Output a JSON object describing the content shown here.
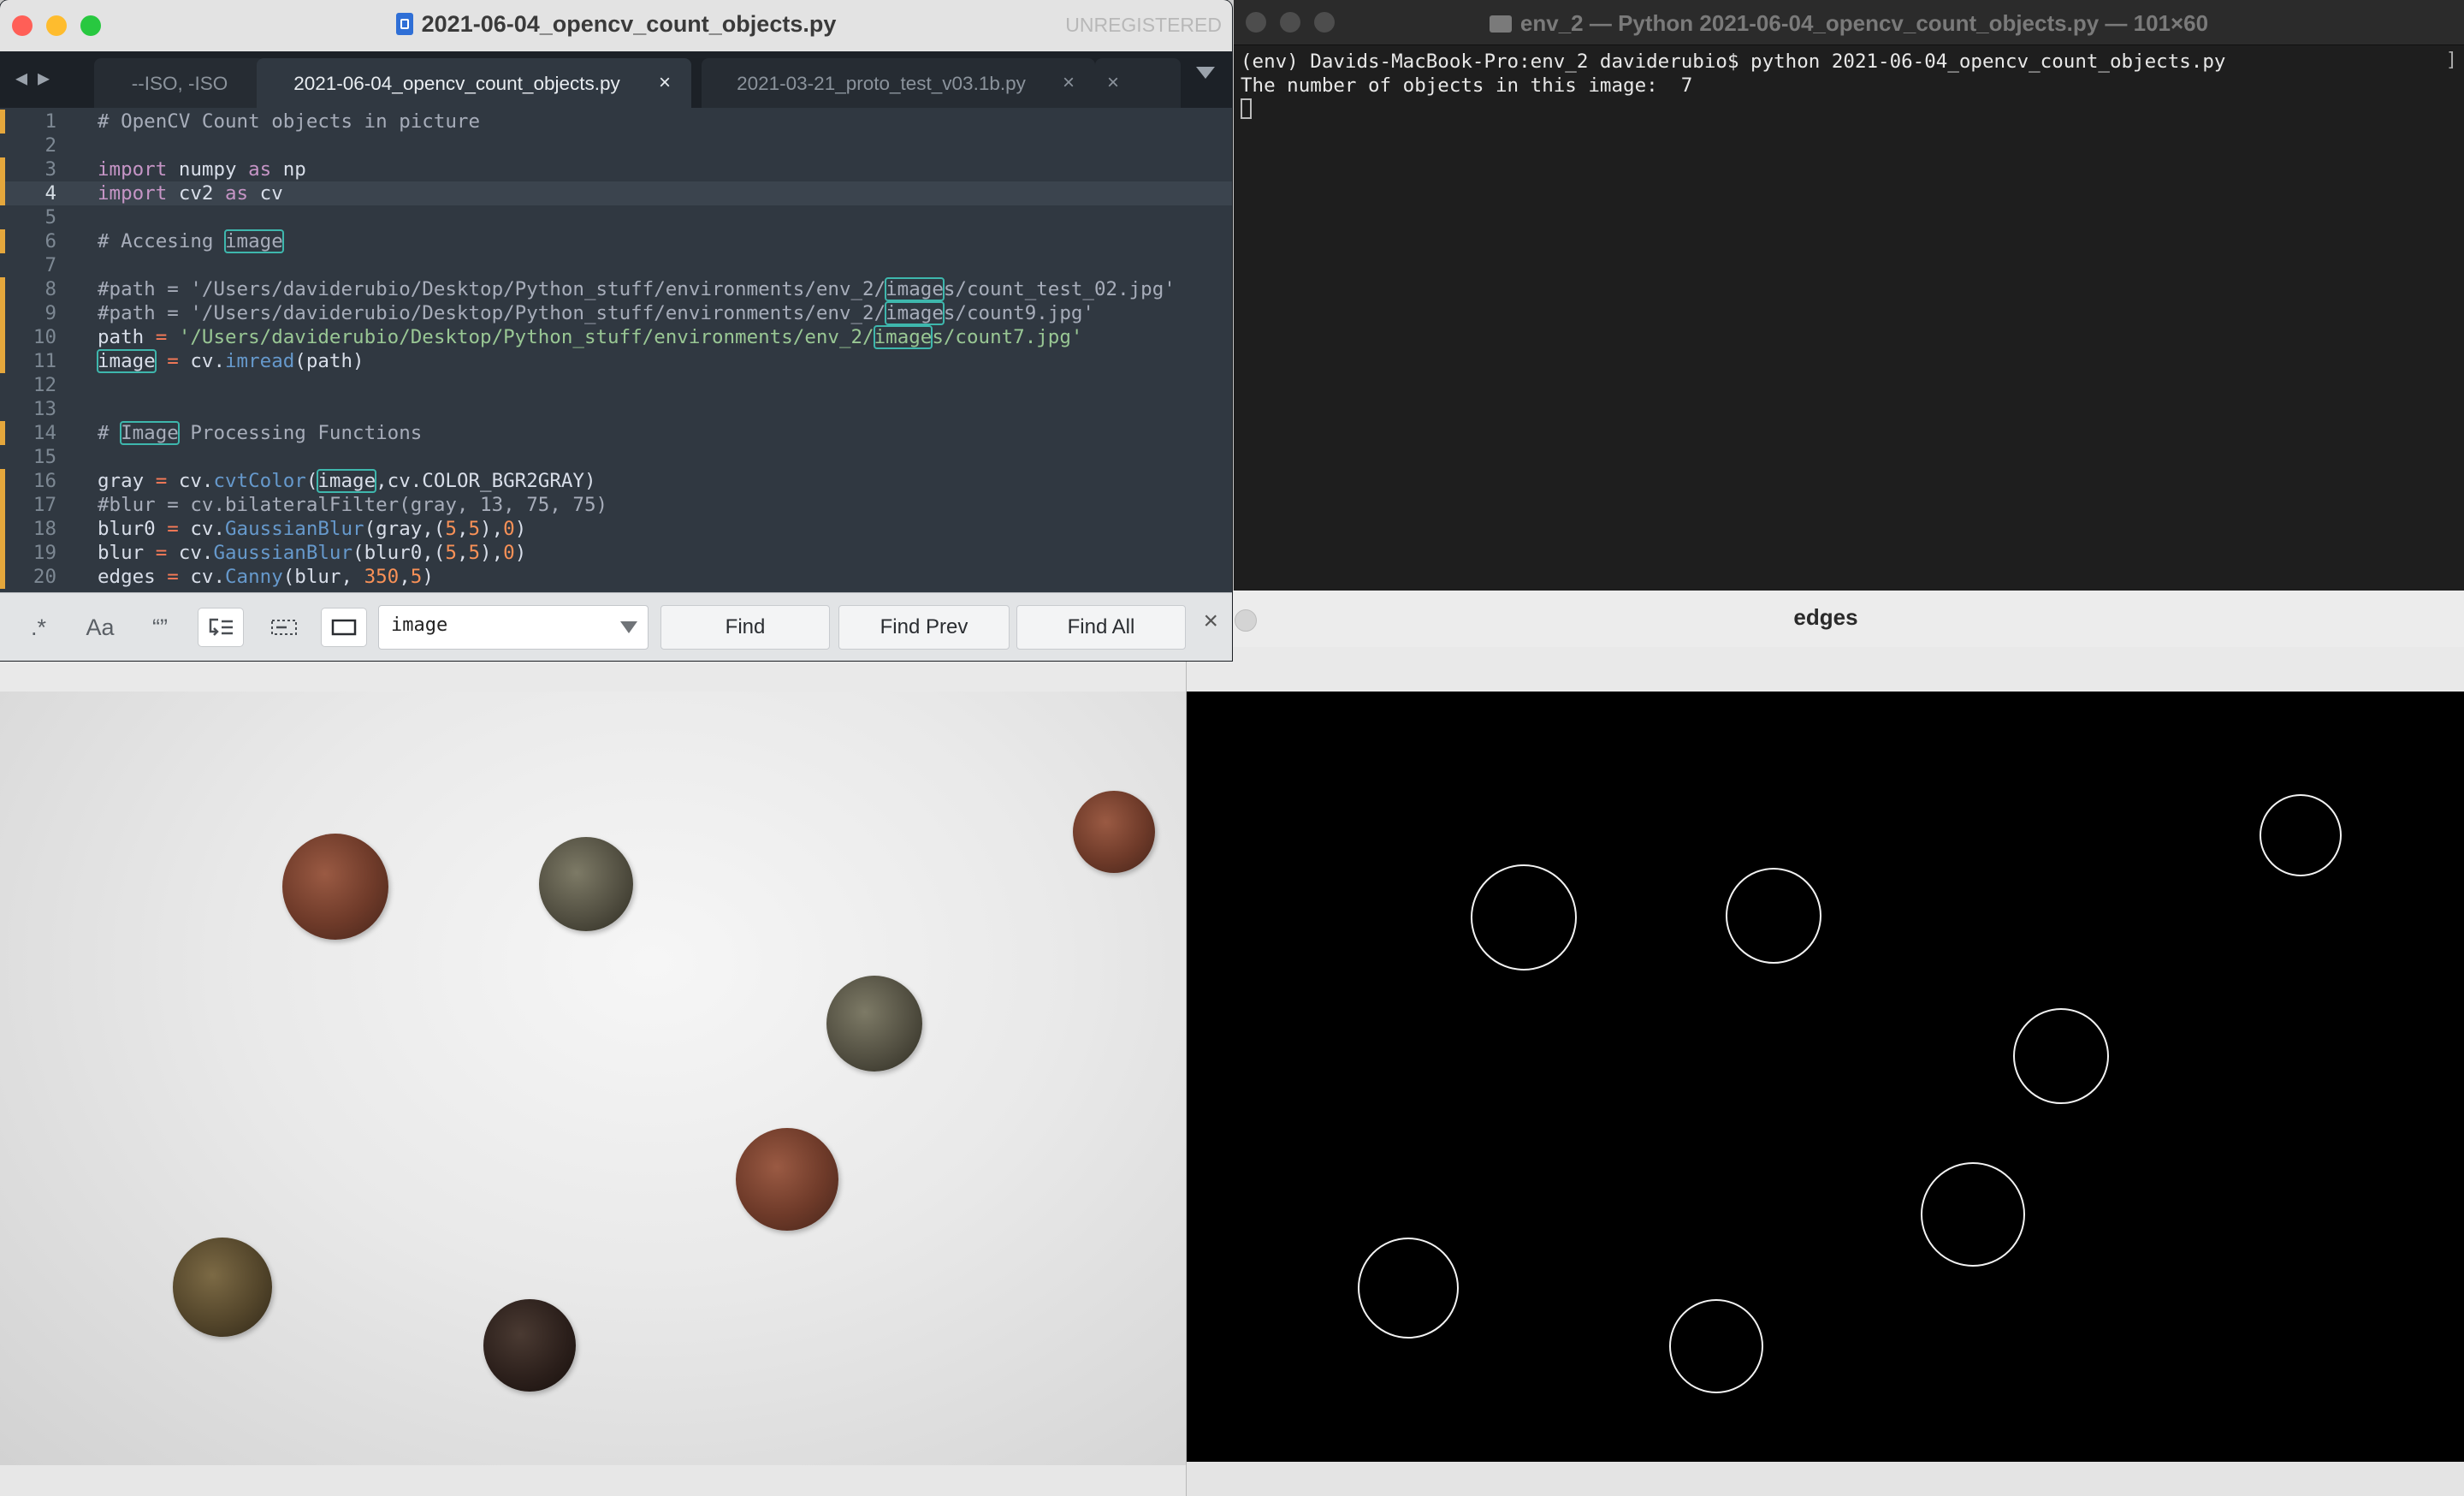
{
  "editor": {
    "title": "2021-06-04_opencv_count_objects.py",
    "license_status": "UNREGISTERED",
    "tabs": [
      {
        "label": "--ISO, -ISO",
        "active": false
      },
      {
        "label": "2021-06-04_opencv_count_objects.py",
        "active": true,
        "close": "×"
      },
      {
        "label": "2021-03-21_proto_test_v03.1b.py",
        "active": false,
        "close": "×"
      },
      {
        "label": "",
        "active": false,
        "close": "×"
      }
    ],
    "current_line": 4,
    "lines": [
      {
        "n": "1",
        "html": "<span class='c-com'># OpenCV Count objects in picture</span>"
      },
      {
        "n": "2",
        "html": ""
      },
      {
        "n": "3",
        "html": "<span class='c-kw'>import</span> numpy <span class='c-kw'>as</span> np"
      },
      {
        "n": "4",
        "html": "<span class='c-kw'>import</span> cv2 <span class='c-kw'>as</span> cv"
      },
      {
        "n": "5",
        "html": ""
      },
      {
        "n": "6",
        "html": "<span class='c-com'># Accesing <span class='hl'>image</span></span>"
      },
      {
        "n": "7",
        "html": ""
      },
      {
        "n": "8",
        "html": "<span class='c-com'>#path = '/Users/daviderubio/Desktop/Python_stuff/environments/env_2/<span class='hl'>image</span>s/count_test_02.jpg'</span>"
      },
      {
        "n": "9",
        "html": "<span class='c-com'>#path = '/Users/daviderubio/Desktop/Python_stuff/environments/env_2/<span class='hl'>image</span>s/count9.jpg'</span>"
      },
      {
        "n": "10",
        "html": "path <span class='c-op'>=</span> <span class='c-str'>'/Users/daviderubio/Desktop/Python_stuff/environments/env_2/<span class='hl'>image</span>s/count7.jpg'</span>"
      },
      {
        "n": "11",
        "html": "<span class='hl'>image</span> <span class='c-op'>=</span> cv.<span class='c-fn'>imread</span>(path)"
      },
      {
        "n": "12",
        "html": ""
      },
      {
        "n": "13",
        "html": ""
      },
      {
        "n": "14",
        "html": "<span class='c-com'># <span class='hl'>Image</span> Processing Functions</span>"
      },
      {
        "n": "15",
        "html": ""
      },
      {
        "n": "16",
        "html": "gray <span class='c-op'>=</span> cv.<span class='c-fn'>cvtColor</span>(<span class='hl'>image</span>,cv.COLOR_BGR2GRAY)"
      },
      {
        "n": "17",
        "html": "<span class='c-com'>#blur = cv.bilateralFilter(gray, 13, 75, 75)</span>"
      },
      {
        "n": "18",
        "html": "blur0 <span class='c-op'>=</span> cv.<span class='c-fn'>GaussianBlur</span>(gray,(<span class='c-num'>5</span>,<span class='c-num'>5</span>),<span class='c-num'>0</span>)"
      },
      {
        "n": "19",
        "html": "blur <span class='c-op'>=</span> cv.<span class='c-fn'>GaussianBlur</span>(blur0,(<span class='c-num'>5</span>,<span class='c-num'>5</span>),<span class='c-num'>0</span>)"
      },
      {
        "n": "20",
        "html": "edges <span class='c-op'>=</span> cv.<span class='c-fn'>Canny</span>(blur, <span class='c-num'>350</span>,<span class='c-num'>5</span>)"
      }
    ],
    "find": {
      "regex_icon": ".*",
      "case_icon": "Aa",
      "word_icon": "“”",
      "query": "image",
      "find_label": "Find",
      "find_prev_label": "Find Prev",
      "find_all_label": "Find All",
      "close": "×"
    }
  },
  "terminal": {
    "title": "env_2 — Python 2021-06-04_opencv_count_objects.py — 101×60",
    "prompt_line": "(env) Davids-MacBook-Pro:env_2 daviderubio$ python 2021-06-04_opencv_count_objects.py",
    "output_line": "The number of objects in this image:  7",
    "right_mark": "]"
  },
  "edges_window": {
    "title": "edges"
  },
  "colors": {
    "mac_close": "#ff5f57",
    "mac_minimize": "#febc2e",
    "mac_zoom": "#28c840",
    "editor_bg": "#303841",
    "highlight_outline": "#3eb7ad"
  },
  "icons": [
    "file-icon",
    "folder-icon",
    "back-arrow-icon",
    "forward-arrow-icon",
    "tab-dropdown-icon",
    "regex-toggle-icon",
    "case-toggle-icon",
    "whole-word-icon",
    "wrap-toggle-icon",
    "in-selection-icon",
    "highlight-matches-icon",
    "dropdown-caret-icon",
    "close-icon"
  ]
}
